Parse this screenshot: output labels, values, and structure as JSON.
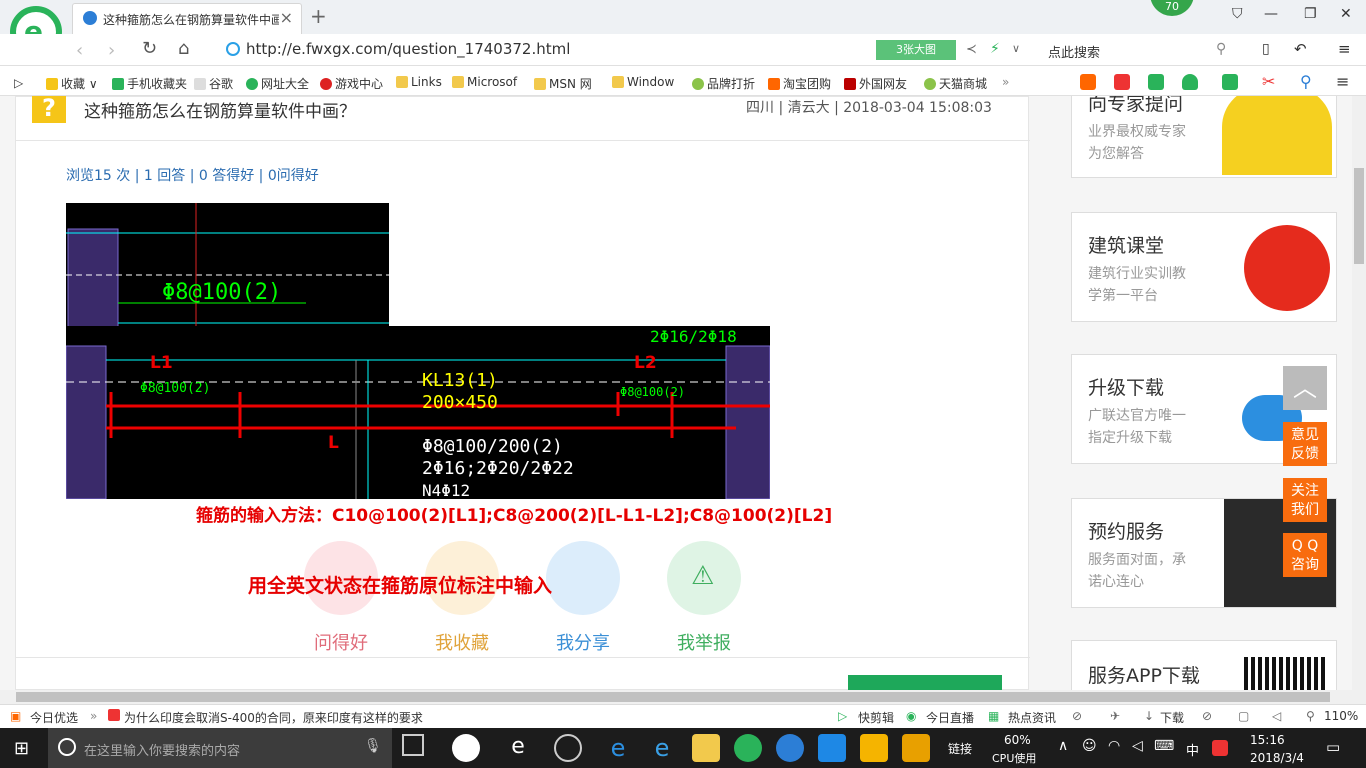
{
  "browser": {
    "tab_title": "这种箍筋怎么在钢筋算量软件中画",
    "badge": "70",
    "url": "http://e.fwxgx.com/question_1740372.html",
    "big_image_btn": "3张大图",
    "search_placeholder": "点此搜索"
  },
  "bookmarks": [
    "收藏",
    "手机收藏夹",
    "谷歌",
    "网址大全",
    "游戏中心",
    "Links",
    "Microsof",
    "MSN 网",
    "Window",
    "品牌打折",
    "淘宝团购",
    "外国网友",
    "天猫商城"
  ],
  "question": {
    "title": "这种箍筋怎么在钢筋算量软件中画？",
    "meta": "四川 | 清云大 | 2018-03-04 15:08:03",
    "stats": "浏览15 次 | 1 回答 | 0 答得好 | 0问得好"
  },
  "cad": {
    "label1": "Φ8@100(2)",
    "label2": "2Φ16/2Φ18",
    "l1": "L1",
    "l2": "L2",
    "l": "L",
    "small1": "Φ8@100(2)",
    "small2": "Φ8@100(2)",
    "kl": "KL13(1)",
    "size": "200×450",
    "b1": "Φ8@100/200(2)",
    "b2": "2Φ16;2Φ20/2Φ22",
    "b3": "N4Φ12"
  },
  "annotation": {
    "line1": "箍筋的输入方法：C10@100(2)[L1];C8@200(2)[L-L1-L2];C8@100(2)[L2]",
    "line2": "用全英文状态在箍筋原位标注中输入"
  },
  "actions": [
    {
      "label": "问得好",
      "color": "#e06c7a",
      "bg": "#fde3e6"
    },
    {
      "label": "我收藏",
      "color": "#e0a33a",
      "bg": "#fdf0d8"
    },
    {
      "label": "我分享",
      "color": "#3b8fd6",
      "bg": "#dcedfb"
    },
    {
      "label": "我举报",
      "color": "#3fae5f",
      "bg": "#dff4e5"
    }
  ],
  "sidebar": {
    "cards": [
      {
        "title": "向专家提问",
        "desc1": "业界最权威专家",
        "desc2": "为您解答"
      },
      {
        "title": "建筑课堂",
        "desc1": "建筑行业实训教",
        "desc2": "学第一平台"
      },
      {
        "title": "升级下载",
        "desc1": "广联达官方唯一",
        "desc2": "指定升级下载"
      },
      {
        "title": "预约服务",
        "desc1": "服务面对面，承",
        "desc2": "诺心连心"
      },
      {
        "title": "服务APP下载"
      }
    ],
    "feedback": "意见\n反馈",
    "follow": "关注\n我们",
    "qq": "Q Q\n咨询"
  },
  "statusbar": {
    "news_label": "今日优选",
    "news": "为什么印度会取消S-400的合同，原来印度有这样的要求",
    "quickcut": "快剪辑",
    "live": "今日直播",
    "hot": "热点资讯",
    "download": "下载",
    "zoom": "110%"
  },
  "taskbar": {
    "search": "在这里输入你要搜索的内容",
    "link": "链接",
    "cpu": "60%",
    "cpu_label": "CPU使用",
    "ime": "中",
    "time": "15:16",
    "date": "2018/3/4"
  }
}
